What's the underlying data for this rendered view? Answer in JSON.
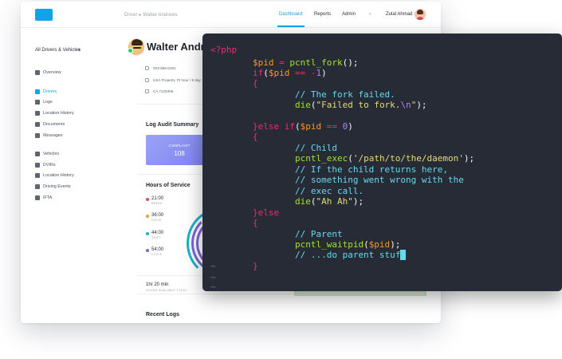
{
  "app": {
    "breadcrumb": {
      "parent": "Driver",
      "separator": "▸",
      "current": "Walter Andrews"
    },
    "nav": {
      "dashboard": "Dashboard",
      "reports": "Reports",
      "admin": "Admin"
    },
    "user_name": "Zulal Ahmad",
    "accent": "#0fa3e8"
  },
  "sidebar": {
    "selector": "All Drivers & Vehicles",
    "items": [
      {
        "label": "Overview",
        "icon": "dashboard-icon"
      },
      {
        "label": "Drivers",
        "icon": "driver-icon",
        "active": true
      },
      {
        "label": "Logs",
        "icon": "log-icon"
      },
      {
        "label": "Location History",
        "icon": "location-icon"
      },
      {
        "label": "Documents",
        "icon": "document-icon"
      },
      {
        "label": "Messages",
        "icon": "message-icon"
      },
      {
        "label": "Vehicles",
        "icon": "vehicle-icon"
      },
      {
        "label": "DVIRs",
        "icon": "wrench-icon"
      },
      {
        "label": "Location History",
        "icon": "location-icon"
      },
      {
        "label": "Driving Events",
        "icon": "calendar-icon"
      },
      {
        "label": "IFTA",
        "icon": "report-icon"
      }
    ]
  },
  "profile": {
    "name": "Walter Andrews",
    "phone": "203-555-0191",
    "property": "USA Property 70 hour / 8 day",
    "license": "CA 7125405"
  },
  "log_audit": {
    "title": "Log Audit Summary",
    "compliant_label": "COMPLIANT",
    "compliant_value": "108"
  },
  "hours_of_service": {
    "title": "Hours of Service",
    "rows": [
      {
        "time": "21:00",
        "label": "BREAK",
        "color": "#e4447a"
      },
      {
        "time": "36:00",
        "label": "DRIVE",
        "color": "#f39c34"
      },
      {
        "time": "44:00",
        "label": "SHIFT",
        "color": "#16b3c9"
      },
      {
        "time": "54:00",
        "label": "CYCLE",
        "color": "#7b63d8"
      }
    ],
    "total": "1hr 20 min",
    "total_label": "HOURS AVAILABLE TODAY"
  },
  "recent_logs": {
    "title": "Recent Logs"
  },
  "terminal": {
    "lines": [
      "<?php",
      "        $pid = pcntl_fork();",
      "        if($pid == -1)",
      "        {",
      "                // The fork failed.",
      "                die(\"Failed to fork.\\n\");",
      "",
      "        }else if($pid == 0)",
      "        {",
      "                // Child",
      "                pcntl_exec('/path/to/the/daemon');",
      "                // If the child returns here,",
      "                // something went wrong with the",
      "                // exec call.",
      "                die(\"Ah Ah\");",
      "        }else",
      "        {",
      "                // Parent",
      "                pcntl_waitpid($pid);",
      "                // ...do parent stuf",
      "        }",
      "",
      "~",
      "~"
    ]
  }
}
